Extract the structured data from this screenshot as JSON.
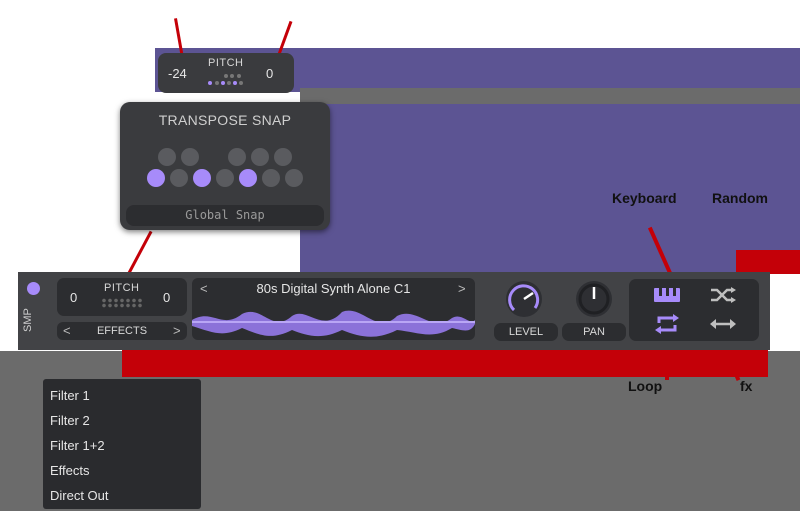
{
  "top_pitch": {
    "left_value": "-24",
    "label": "PITCH",
    "right_value": "0"
  },
  "transpose_snap": {
    "title": "TRANSPOSE SNAP",
    "global_snap_label": "Global Snap"
  },
  "strip": {
    "smp_label": "SMP",
    "pitch": {
      "left_value": "0",
      "label": "PITCH",
      "right_value": "0"
    },
    "effects": {
      "prev": "<",
      "label": "EFFECTS",
      "next": ">"
    },
    "sample": {
      "prev": "<",
      "name": "80s Digital Synth Alone C1",
      "next": ">"
    },
    "level_label": "LEVEL",
    "pan_label": "PAN",
    "icons": [
      "keyboard-icon",
      "shuffle-icon",
      "loop-icon",
      "swap-arrows-icon"
    ]
  },
  "effects_menu": [
    "Filter 1",
    "Filter 2",
    "Filter 1+2",
    "Effects",
    "Direct Out"
  ],
  "annotations": {
    "a": "Keyboard",
    "b": "Random",
    "c": "Loop",
    "d": "fx"
  },
  "colors": {
    "accent": "#a78bfa",
    "annotation": "#c40008",
    "panel": "#424346"
  }
}
